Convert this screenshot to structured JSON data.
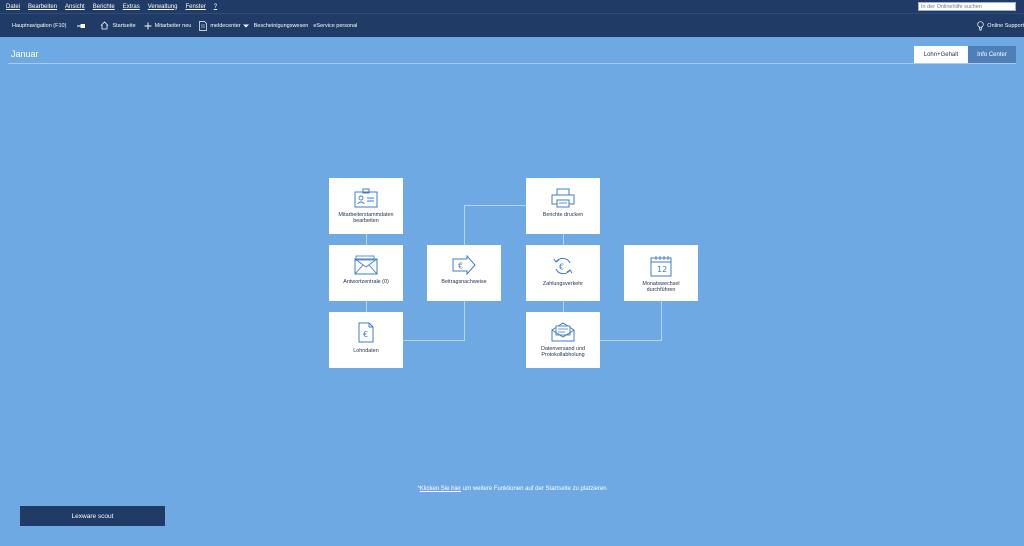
{
  "menubar": {
    "items": [
      "Datei",
      "Bearbeiten",
      "Ansicht",
      "Berichte",
      "Extras",
      "Verwaltung",
      "Fenster",
      "?"
    ],
    "search_placeholder": "In der Onlinehilfe suchen"
  },
  "toolbar": {
    "main_nav": "Hauptnavigation (F10)",
    "start": "Startseite",
    "new_employee": "Mitarbeiter neu",
    "meldecenter": "meldecenter",
    "certificates": "Bescheinigungswesen",
    "eservice": "eService personal",
    "online_support": "Online Support"
  },
  "header": {
    "title": "Januar",
    "tabs": [
      {
        "label": "Lohn+Gehalt",
        "active": true
      },
      {
        "label": "Info Center",
        "active": false
      }
    ]
  },
  "tiles": {
    "stammdaten": "Mitarbeiterstammdaten bearbeiten",
    "antwortzentrale": "Antwortzentrale (0)",
    "lohndaten": "Lohndaten",
    "beitragsnachweise": "Beitragsnachweise",
    "berichte": "Berichte drucken",
    "zahlungsverkehr": "Zahlungsverkehr",
    "datenversand": "Datenversand und Protokollabholung",
    "monatswechsel": "Monatswechsel durchführen"
  },
  "calendar_day": "12",
  "hint": {
    "prefix": "*",
    "link": "Klicken Sie hier",
    "text": " um weitere Funktionen auf der Startseite zu platzieren"
  },
  "scout_button": "Lexware scout"
}
